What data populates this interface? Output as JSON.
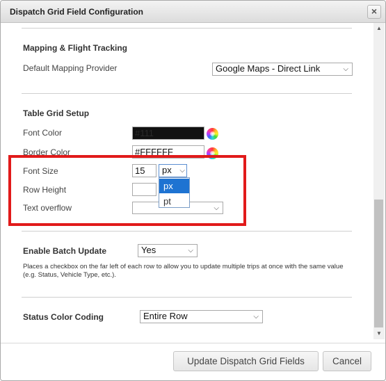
{
  "dialog": {
    "title": "Dispatch Grid Field Configuration",
    "close_glyph": "×"
  },
  "icons": {
    "close": "close-icon",
    "color_picker": "color-wheel-icon",
    "chevron": "chevron-down-icon",
    "scroll_up": "arrow-up-icon",
    "scroll_down": "arrow-down-icon"
  },
  "mapping": {
    "title": "Mapping & Flight Tracking",
    "provider_label": "Default Mapping Provider",
    "provider_value": "Google Maps - Direct Link"
  },
  "table_grid": {
    "title": "Table Grid Setup",
    "font_color_label": "Font Color",
    "font_color_value": "#111",
    "border_color_label": "Border Color",
    "border_color_value": "#FFFFFF",
    "font_size_label": "Font Size",
    "font_size_value": "15",
    "font_size_unit": "px",
    "unit_options": [
      "px",
      "pt"
    ],
    "row_height_label": "Row Height",
    "row_height_value": "",
    "text_overflow_label": "Text overflow",
    "text_overflow_value": ""
  },
  "batch": {
    "label": "Enable Batch Update",
    "value": "Yes",
    "description": "Places a checkbox on the far left of each row to allow you to update multiple trips at once with the same value (e.g. Status, Vehicle Type, etc.)."
  },
  "status": {
    "label": "Status Color Coding",
    "value": "Entire Row"
  },
  "footer": {
    "update_label": "Update Dispatch Grid Fields",
    "cancel_label": "Cancel"
  },
  "colors": {
    "highlight": "#e11a1a",
    "selected_option": "#1e73d2",
    "font_color_swatch": "#111111"
  },
  "arrows": {
    "down": "▼",
    "up": "▲",
    "chevron": "⌵"
  }
}
